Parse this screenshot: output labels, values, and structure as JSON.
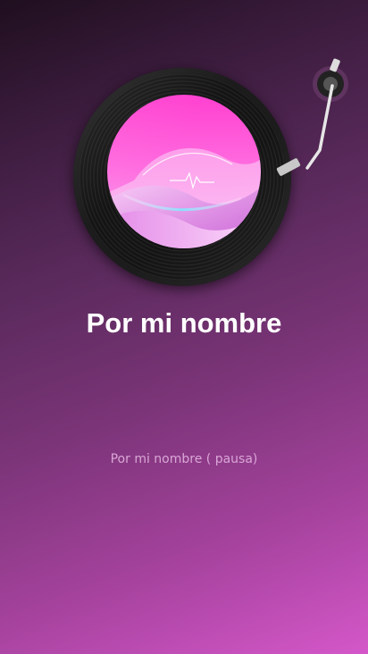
{
  "player": {
    "song_title": "Por mi nombre",
    "status_text": "Por mi nombre ( pausa)"
  },
  "theme": {
    "background_top": "#1f0f1f",
    "background_bottom": "#d457c9",
    "cover_pink": "#ff4fd8",
    "cover_cyan": "#7fe6ff"
  },
  "icons": {
    "record": "vinyl-record-icon",
    "tonearm": "turntable-tonearm-icon",
    "cover": "album-cover-art"
  }
}
